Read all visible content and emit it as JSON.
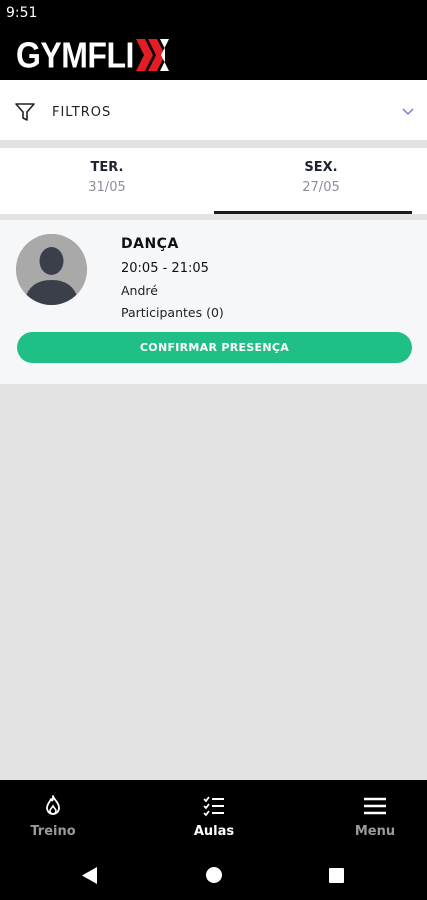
{
  "status": {
    "time": "9:51"
  },
  "app": {
    "logo_text": "GYMFLI",
    "brand_color": "#e21d24"
  },
  "filters": {
    "label": "FILTROS",
    "icon": "filter-icon",
    "chevron": "chevron-down-icon",
    "chevron_color": "#7b7bdc"
  },
  "tabs": [
    {
      "day": "TER.",
      "date": "31/05",
      "selected": false
    },
    {
      "day": "SEX.",
      "date": "27/05",
      "selected": true
    }
  ],
  "classes": [
    {
      "name": "DANÇA",
      "time": "20:05 - 21:05",
      "instructor": "André",
      "participants": "Participantes (0)",
      "action_label": "CONFIRMAR PRESENÇA",
      "action_color": "#1fbf86"
    }
  ],
  "bottom_nav": [
    {
      "label": "Treino",
      "icon": "flame-icon",
      "active": false
    },
    {
      "label": "Aulas",
      "icon": "checklist-icon",
      "active": true
    },
    {
      "label": "Menu",
      "icon": "hamburger-menu-icon",
      "active": false
    }
  ],
  "system_nav": [
    "back-icon",
    "home-icon",
    "recents-icon"
  ]
}
